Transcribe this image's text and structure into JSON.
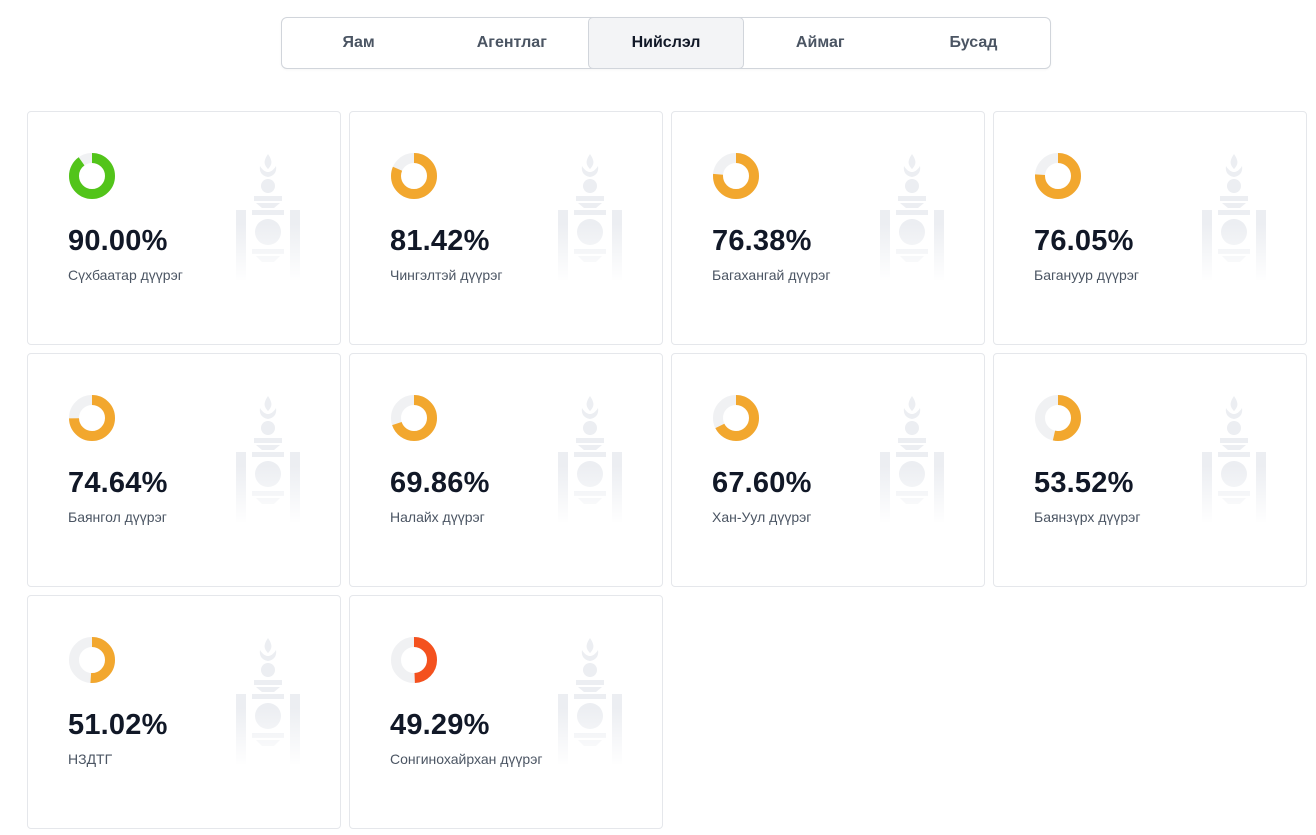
{
  "tabs": [
    {
      "label": "Яам",
      "active": false
    },
    {
      "label": "Агентлаг",
      "active": false
    },
    {
      "label": "Нийслэл",
      "active": true
    },
    {
      "label": "Аймаг",
      "active": false
    },
    {
      "label": "Бусад",
      "active": false
    }
  ],
  "colors": {
    "green": "#52c41a",
    "orange": "#f2a72e",
    "red": "#f4511e",
    "track": "#f0f1f3"
  },
  "cards": [
    {
      "percent_text": "90.00%",
      "value": 90.0,
      "name": "Сүхбаатар дүүрэг",
      "color": "#52c41a"
    },
    {
      "percent_text": "81.42%",
      "value": 81.42,
      "name": "Чингэлтэй дүүрэг",
      "color": "#f2a72e"
    },
    {
      "percent_text": "76.38%",
      "value": 76.38,
      "name": "Багахангай дүүрэг",
      "color": "#f2a72e"
    },
    {
      "percent_text": "76.05%",
      "value": 76.05,
      "name": "Багануур дүүрэг",
      "color": "#f2a72e"
    },
    {
      "percent_text": "74.64%",
      "value": 74.64,
      "name": "Баянгол дүүрэг",
      "color": "#f2a72e"
    },
    {
      "percent_text": "69.86%",
      "value": 69.86,
      "name": "Налайх дүүрэг",
      "color": "#f2a72e"
    },
    {
      "percent_text": "67.60%",
      "value": 67.6,
      "name": "Хан-Уул дүүрэг",
      "color": "#f2a72e"
    },
    {
      "percent_text": "53.52%",
      "value": 53.52,
      "name": "Баянзүрх дүүрэг",
      "color": "#f2a72e"
    },
    {
      "percent_text": "51.02%",
      "value": 51.02,
      "name": "НЗДТГ",
      "color": "#f2a72e"
    },
    {
      "percent_text": "49.29%",
      "value": 49.29,
      "name": "Сонгинохайрхан дүүрэг",
      "color": "#f4511e"
    }
  ]
}
